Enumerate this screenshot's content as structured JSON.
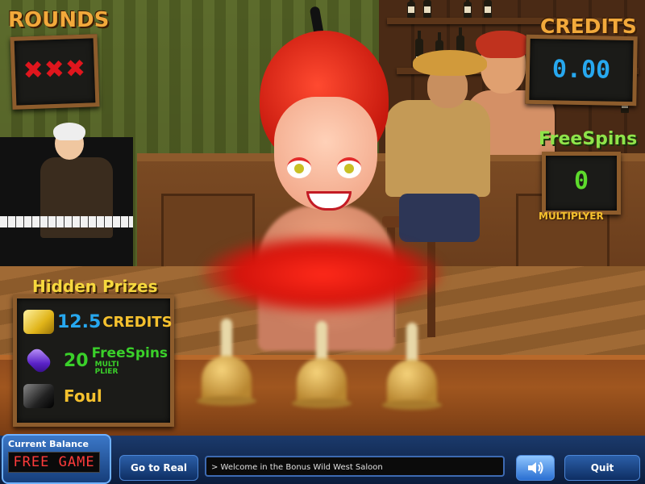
{
  "hud": {
    "rounds_title": "ROUNDS",
    "rounds_marks": "✖✖✖",
    "credits_title": "CREDITS",
    "credits_value": "0.00",
    "freespins_title": "FreeSpins",
    "freespins_value": "0",
    "multiplier_label": "MULTIPLYER"
  },
  "hidden_prizes": {
    "title": "Hidden Prizes",
    "rows": [
      {
        "icon": "gold-bars-icon",
        "amount": "12.5",
        "label": "CREDITS",
        "amount_color": "#27a8ef",
        "label_color": "#f5c12e"
      },
      {
        "icon": "purple-gem-icon",
        "amount": "20",
        "label": "FreeSpins",
        "sub": "MULTI PLIER",
        "amount_color": "#3ad02a",
        "label_color": "#3ad02a"
      },
      {
        "icon": "anvil-icon",
        "amount": "",
        "label": "Foul",
        "label_color": "#f5c12e"
      }
    ]
  },
  "bottom": {
    "balance_title": "Current Balance",
    "balance_value": "FREE GAME",
    "go_to_real": "Go to Real",
    "message": "> Welcome in the Bonus Wild West Saloon",
    "quit": "Quit",
    "sound_icon": "speaker-icon"
  },
  "colors": {
    "accent_orange": "#f2a93b",
    "credits_blue": "#27a8ef",
    "freespins_green": "#5ddb2c",
    "rounds_red": "#e0161d",
    "bar_blue": "#163e7a"
  }
}
